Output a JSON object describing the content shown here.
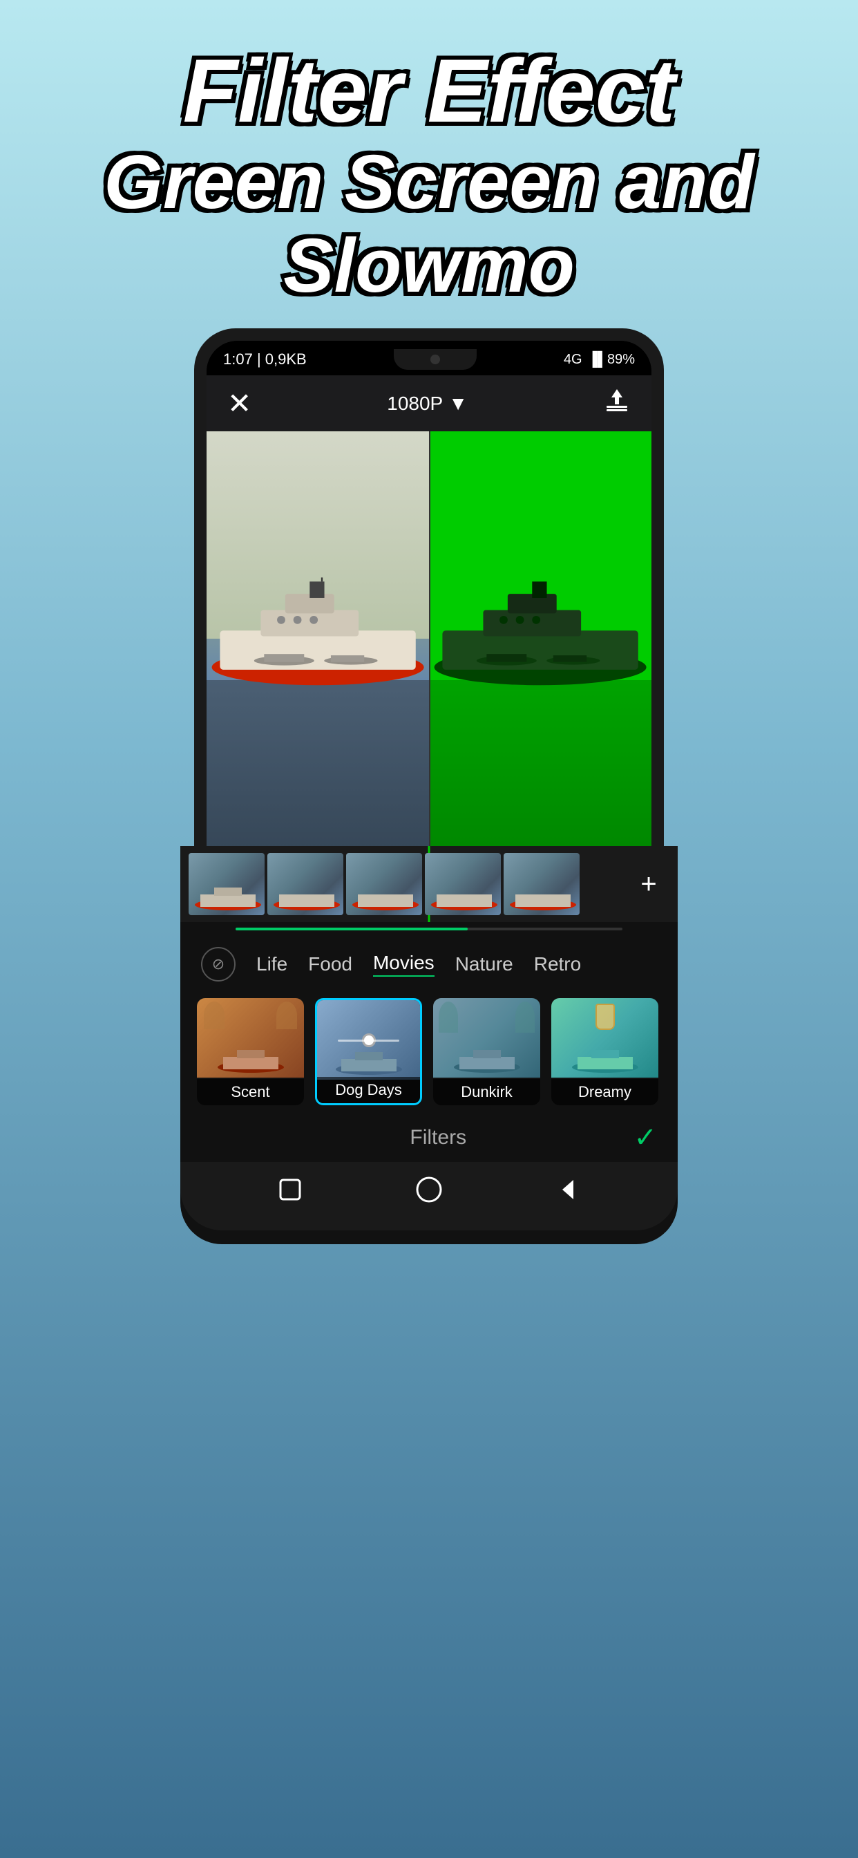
{
  "header": {
    "line1": "Filter Effect",
    "line2": "Green Screen and Slowmo"
  },
  "statusBar": {
    "time": "1:07",
    "network": "0,9KB",
    "signal": "4G",
    "battery": "89%"
  },
  "toolbar": {
    "closeLabel": "✕",
    "quality": "1080P",
    "qualityArrow": "▼",
    "exportIcon": "↑"
  },
  "timeline": {
    "addLabel": "+"
  },
  "filterCategories": {
    "noFilter": "⊘",
    "items": [
      {
        "label": "Life",
        "active": false
      },
      {
        "label": "Food",
        "active": false
      },
      {
        "label": "Movies",
        "active": true
      },
      {
        "label": "Nature",
        "active": false
      },
      {
        "label": "Retro",
        "active": false
      }
    ]
  },
  "filterItems": [
    {
      "label": "Scent",
      "active": false
    },
    {
      "label": "Dog Days",
      "active": false
    },
    {
      "label": "Dunkirk",
      "active": false
    },
    {
      "label": "Dreamy",
      "active": true
    }
  ],
  "filtersFooter": {
    "label": "Filters",
    "checkmark": "✓"
  },
  "navBar": {
    "square": "■",
    "circle": "○",
    "triangle": "◀"
  }
}
